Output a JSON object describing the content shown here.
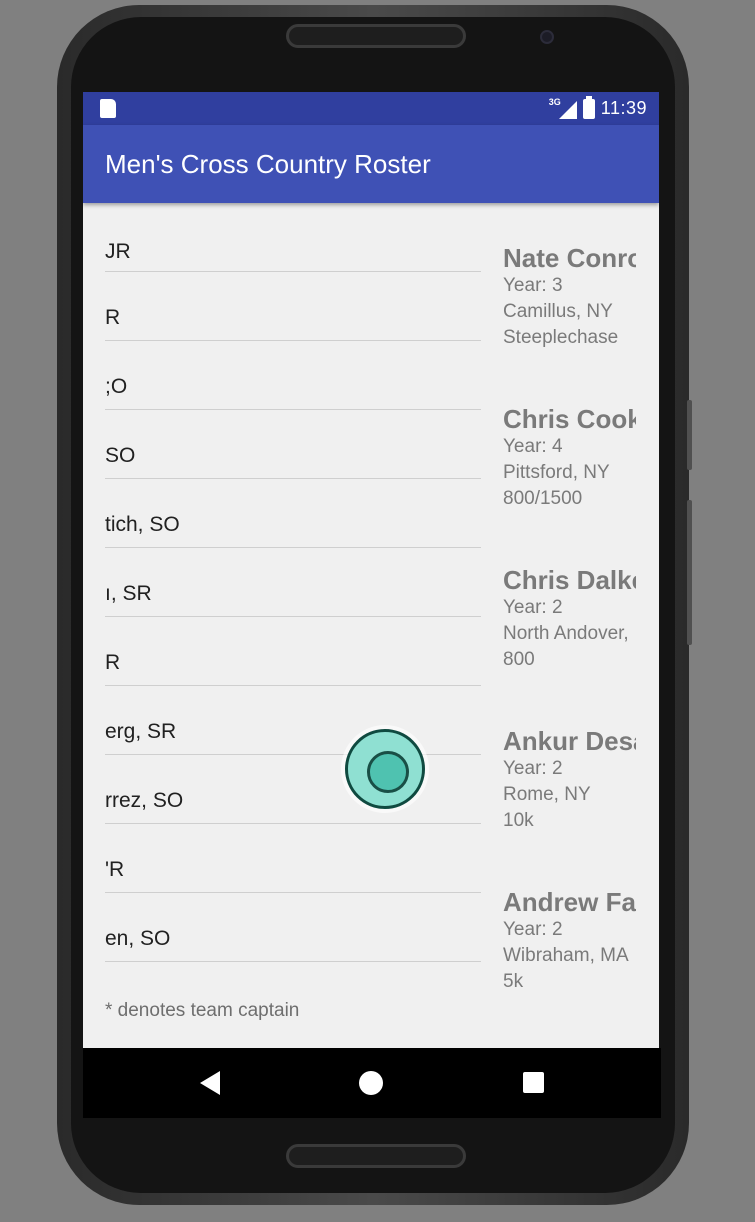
{
  "status_bar": {
    "network_label": "3G",
    "time": "11:39"
  },
  "app_bar": {
    "title": "Men's Cross Country Roster"
  },
  "roster_list": {
    "items": [
      {
        "label": "JR"
      },
      {
        "label": "R"
      },
      {
        "label": ";O"
      },
      {
        "label": "SO"
      },
      {
        "label": "tich, SO"
      },
      {
        "label": "ı, SR"
      },
      {
        "label": "R"
      },
      {
        "label": "erg, SR"
      },
      {
        "label": "rrez, SO"
      },
      {
        "label": "'R"
      },
      {
        "label": "en, SO"
      }
    ],
    "footnote": "* denotes team captain"
  },
  "details": {
    "cards": [
      {
        "name": "Nate Conro",
        "year": "Year: 3",
        "hometown": "Camillus, NY",
        "event": "Steeplechase"
      },
      {
        "name": "Chris Cook",
        "year": "Year: 4",
        "hometown": "Pittsford, NY",
        "event": "800/1500"
      },
      {
        "name": "Chris Dalke",
        "year": "Year: 2",
        "hometown": "North Andover,",
        "event": "800"
      },
      {
        "name": "Ankur Desa",
        "year": "Year: 2",
        "hometown": "Rome, NY",
        "event": "10k"
      },
      {
        "name": "Andrew Fa",
        "year": "Year: 2",
        "hometown": "Wibraham, MA",
        "event": "5k"
      }
    ]
  },
  "icons": {
    "sd_card": "sd-card-icon",
    "signal": "cell-signal-icon",
    "battery": "battery-charging-icon",
    "back": "back-triangle-icon",
    "home": "home-circle-icon",
    "recents": "recents-square-icon",
    "touch": "touch-indicator-icon"
  },
  "colors": {
    "status_bar": "#303f9f",
    "app_bar": "#3f51b5",
    "touch_fill": "#8fe0d2"
  }
}
